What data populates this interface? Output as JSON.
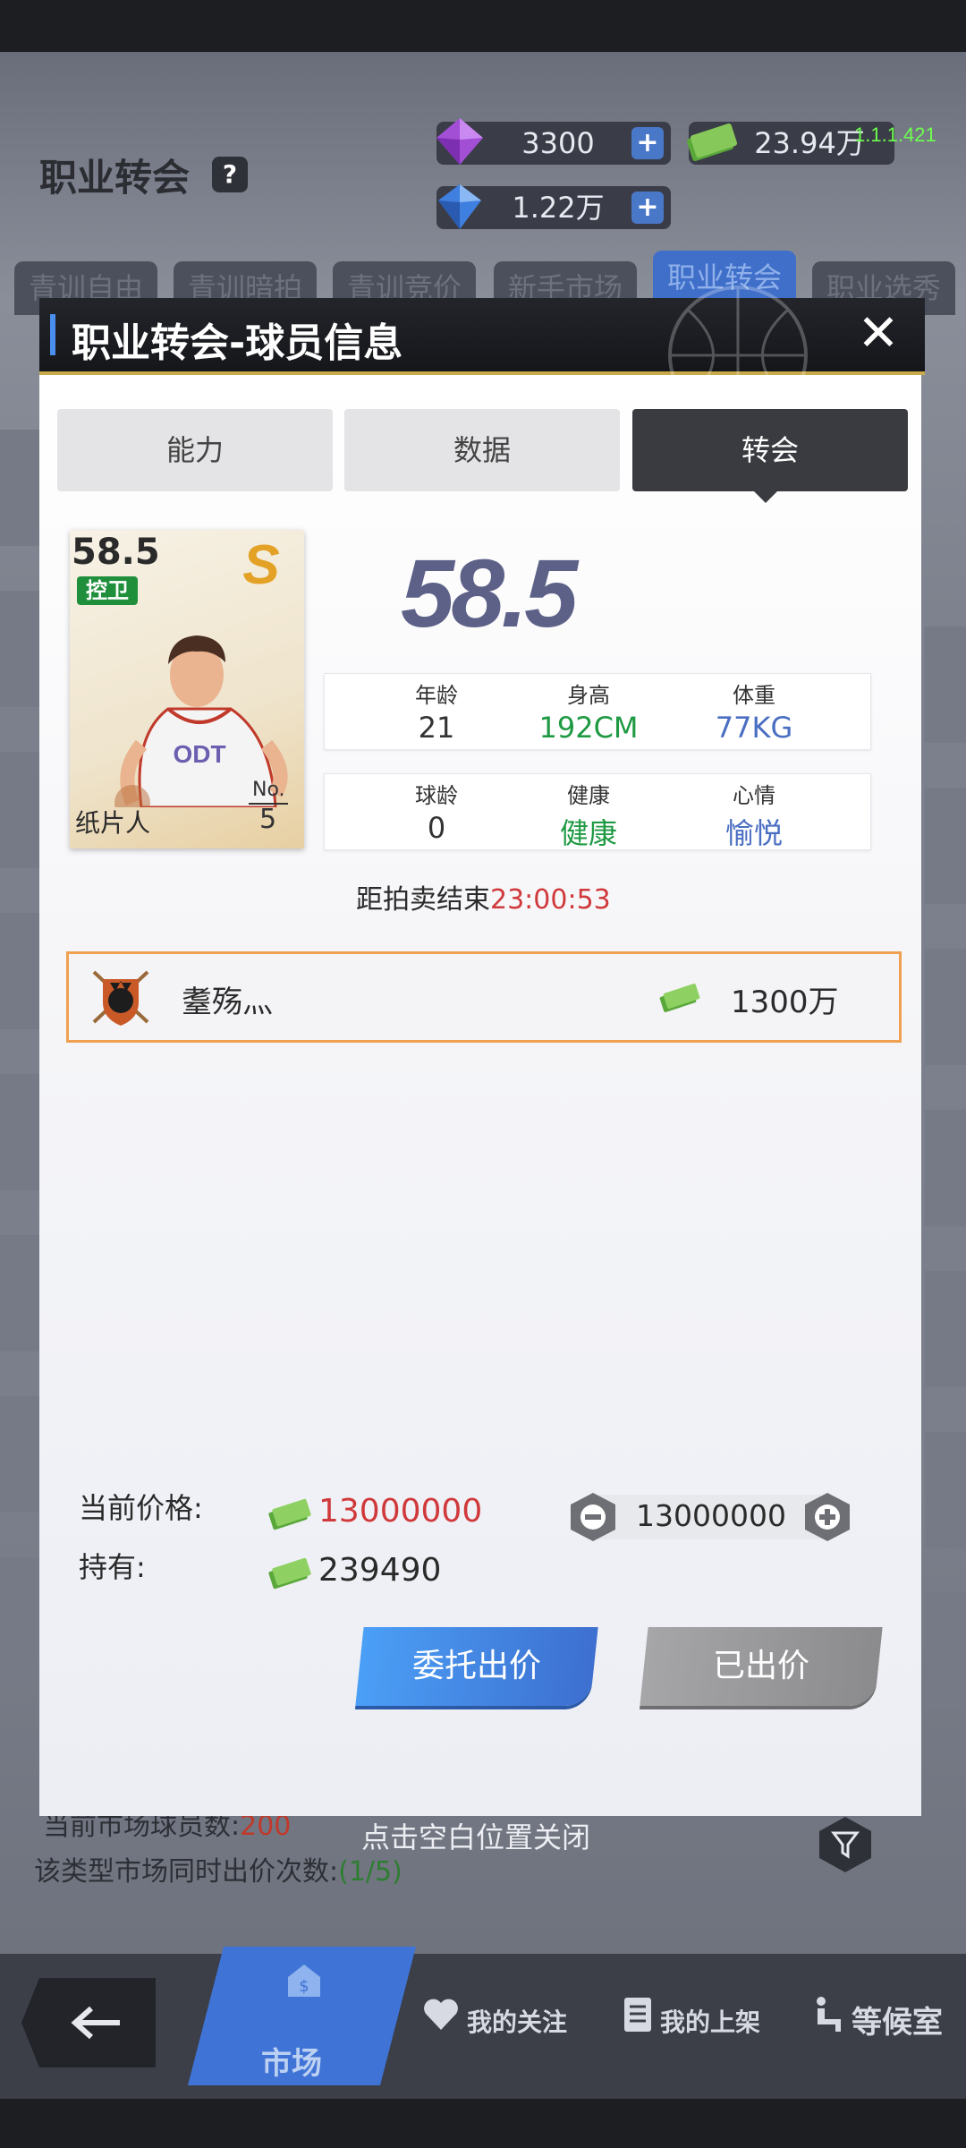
{
  "background": {
    "page_title": "职业转会",
    "currencies": [
      {
        "name": "diamond",
        "value": "3300"
      },
      {
        "name": "cash",
        "value": "23.94万"
      },
      {
        "name": "sapphire",
        "value": "1.22万"
      }
    ],
    "version": "1.1.1.421",
    "tabs": [
      "青训自由",
      "青训暗拍",
      "青训竞价",
      "新手市场",
      "职业转会",
      "职业选秀"
    ],
    "active_tab": "职业转会",
    "market_count_label": "当前市场球员数:",
    "market_count_value": "200",
    "bid_times_label": "该类型市场同时出价次数:",
    "bid_times_value": "(1/5)",
    "close_hint": "点击空白位置关闭",
    "nav": {
      "market": "市场",
      "follow": "我的关注",
      "listed": "我的上架",
      "waiting": "等候室"
    }
  },
  "modal": {
    "title": "职业转会-球员信息",
    "tabs": [
      "能力",
      "数据",
      "转会"
    ],
    "active_tab": "转会",
    "card": {
      "rating": "58.5",
      "position": "控卫",
      "grade": "S",
      "name": "纸片人",
      "no_label": "No.",
      "number": "5"
    },
    "big_rating": "58.5",
    "stats_row1": [
      {
        "label": "年龄",
        "value": "21"
      },
      {
        "label": "身高",
        "value": "192CM"
      },
      {
        "label": "体重",
        "value": "77KG"
      }
    ],
    "stats_row2": [
      {
        "label": "球龄",
        "value": "0"
      },
      {
        "label": "健康",
        "value": "健康"
      },
      {
        "label": "心情",
        "value": "愉悦"
      }
    ],
    "countdown_label": "距拍卖结束",
    "countdown_value": "23:00:53",
    "bid": {
      "bidder": "耋殇灬",
      "amount": "1300万"
    },
    "price_label": "当前价格:",
    "price_value": "13000000",
    "hold_label": "持有:",
    "hold_value": "239490",
    "stepper_value": "13000000",
    "entrust_button": "委托出价",
    "placed_button": "已出价"
  },
  "colors": {
    "accent_blue": "#3d6fd0",
    "price_red": "#d0393b",
    "health_green": "#1f9a43",
    "bid_border": "#f0a050"
  }
}
